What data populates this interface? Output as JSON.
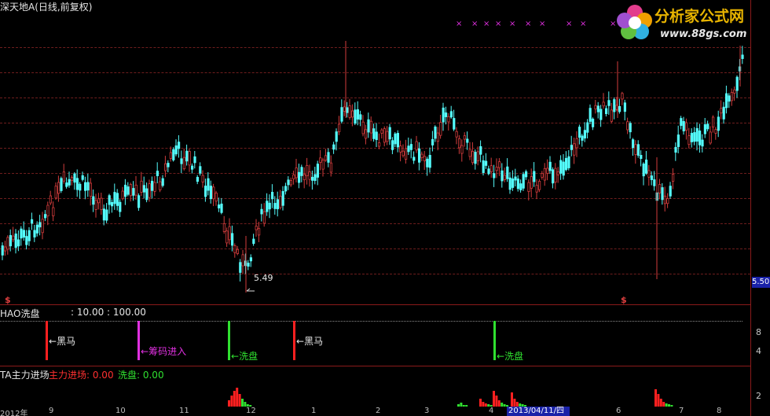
{
  "window": {
    "main_title": "深天地A(日线,前复权)",
    "low_label": "5.49",
    "price_tag": "5.50",
    "colors": {
      "up": "#d23c3c",
      "down": "#54fcfc",
      "background": "#000000"
    }
  },
  "logo": {
    "text": "分析家公式网",
    "url": "www.88gs.com"
  },
  "indicator1": {
    "name": "HAO洗盘",
    "params": ": 10.00 : 100.00",
    "signals": [
      {
        "label": "黑马",
        "color": "#ff2020"
      },
      {
        "label": "筹码进入",
        "color": "#e030e0"
      },
      {
        "label": "洗盘",
        "color": "#30e030"
      },
      {
        "label": "黑马",
        "color": "#ff2020"
      },
      {
        "label": "洗盘",
        "color": "#30e030"
      }
    ],
    "y_labels": [
      "8",
      "4"
    ]
  },
  "indicator2": {
    "name": "TA主力进场",
    "main_label": "主力进场: 0.00",
    "wash_label": "洗盘: 0.00",
    "y_labels": [
      "2"
    ]
  },
  "x_axis": {
    "labels": [
      "2012年",
      "9",
      "10",
      "11",
      "12",
      "1",
      "2",
      "3",
      "4",
      "6",
      "7",
      "8"
    ],
    "cursor_date": "2013/04/11/四"
  },
  "markers": {
    "dollar": "$",
    "cross": "×"
  }
}
